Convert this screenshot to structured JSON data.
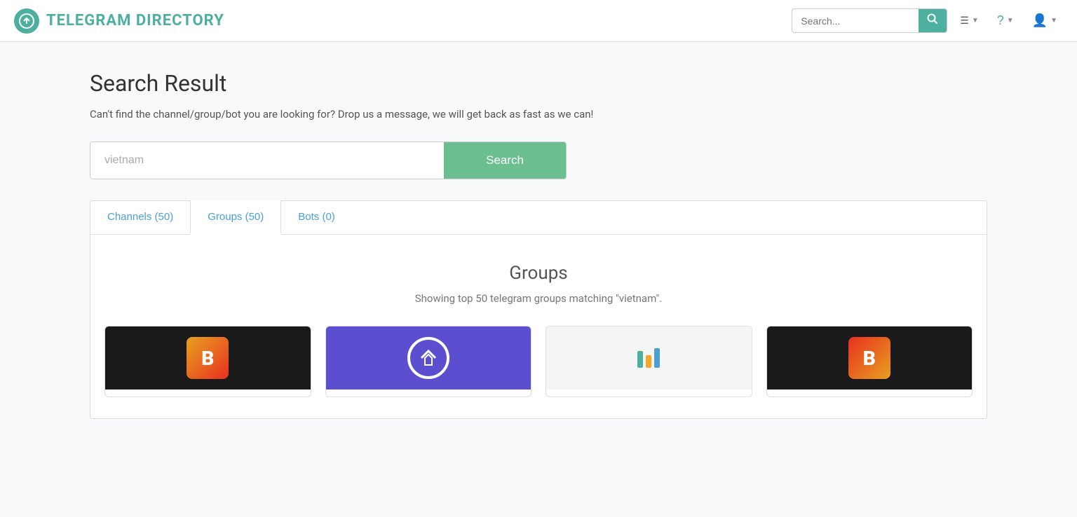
{
  "header": {
    "logo_text": "TELEGRAM DIRECTORY",
    "search_placeholder": "Search...",
    "nav_items": [
      {
        "id": "menu",
        "label": "☰",
        "has_dropdown": true
      },
      {
        "id": "help",
        "label": "?",
        "has_dropdown": true
      },
      {
        "id": "user",
        "label": "👤",
        "has_dropdown": true
      }
    ]
  },
  "page": {
    "title": "Search Result",
    "subtitle": "Can't find the channel/group/bot you are looking for? Drop us a message, we will get back as fast as we can!",
    "search_value": "vietnam",
    "search_button": "Search"
  },
  "tabs": [
    {
      "id": "channels",
      "label": "Channels (50)",
      "active": false
    },
    {
      "id": "groups",
      "label": "Groups (50)",
      "active": true
    },
    {
      "id": "bots",
      "label": "Bots (0)",
      "active": false
    }
  ],
  "content": {
    "section_title": "Groups",
    "section_subtitle": "Showing top 50 telegram groups matching \"vietnam\"."
  },
  "cards": [
    {
      "id": 1,
      "type": "thumb1"
    },
    {
      "id": 2,
      "type": "thumb2"
    },
    {
      "id": 3,
      "type": "thumb3"
    },
    {
      "id": 4,
      "type": "thumb4"
    }
  ]
}
